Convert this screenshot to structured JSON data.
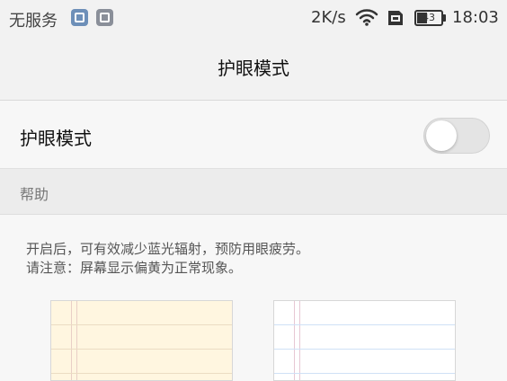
{
  "status_bar": {
    "carrier": "无服务",
    "network_speed": "2K/s",
    "battery": "43",
    "battery_fraction": 0.43,
    "time": "18:03",
    "icons": [
      "photo-icon",
      "gallery-icon",
      "wifi-icon",
      "sim-icon",
      "battery-icon"
    ]
  },
  "header": {
    "title": "护眼模式"
  },
  "setting": {
    "label": "护眼模式",
    "enabled": false
  },
  "help": {
    "section_title": "帮助",
    "line1": "开启后，可有效减少蓝光辐射，预防用眼疲劳。",
    "line2": "请注意：屏幕显示偏黄为正常现象。"
  },
  "colors": {
    "background": "#f7f7f7",
    "toggle_off": "#e4e4e4",
    "warm_paper": "#fff6e0",
    "cool_paper": "#ffffff",
    "cool_rule": "#cfe1f6"
  }
}
